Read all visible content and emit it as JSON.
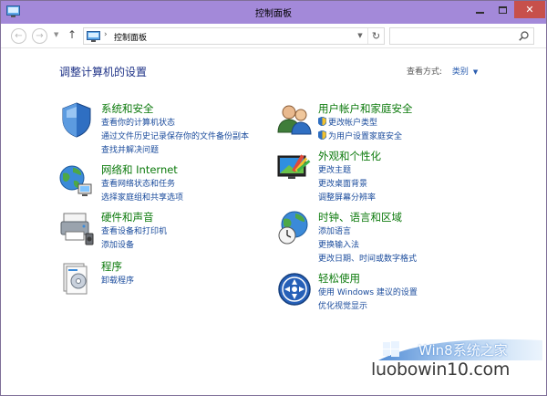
{
  "window": {
    "title": "控制面板"
  },
  "caption": {
    "close_glyph": "✕"
  },
  "nav": {
    "back_glyph": "←",
    "forward_glyph": "→",
    "dropdown_glyph": "▼",
    "up_glyph": "↑",
    "address_separator": "›",
    "address_path": "控制面板",
    "address_dropdown_glyph": "▼",
    "refresh_glyph": "↻",
    "search_placeholder": ""
  },
  "header": {
    "heading": "调整计算机的设置",
    "viewby_label": "查看方式:",
    "viewby_value": "类别",
    "viewby_caret": "▼"
  },
  "categories": [
    {
      "title": "系统和安全",
      "icon": "system-security-icon",
      "links": [
        "查看你的计算机状态",
        "通过文件历史记录保存你的文件备份副本",
        "查找并解决问题"
      ]
    },
    {
      "title": "网络和 Internet",
      "icon": "network-internet-icon",
      "links": [
        "查看网络状态和任务",
        "选择家庭组和共享选项"
      ]
    },
    {
      "title": "硬件和声音",
      "icon": "hardware-sound-icon",
      "links": [
        "查看设备和打印机",
        "添加设备"
      ]
    },
    {
      "title": "程序",
      "icon": "programs-icon",
      "links": [
        "卸载程序"
      ]
    },
    {
      "title": "用户帐户和家庭安全",
      "icon": "user-accounts-icon",
      "links": [
        "更改帐户类型",
        "为用户设置家庭安全"
      ]
    },
    {
      "title": "外观和个性化",
      "icon": "appearance-icon",
      "links": [
        "更改主题",
        "更改桌面背景",
        "调整屏幕分辨率"
      ]
    },
    {
      "title": "时钟、语言和区域",
      "icon": "clock-language-icon",
      "links": [
        "添加语言",
        "更换输入法",
        "更改日期、时间或数字格式"
      ]
    },
    {
      "title": "轻松使用",
      "icon": "ease-of-access-icon",
      "links": [
        "使用 Windows 建议的设置",
        "优化视觉显示"
      ]
    }
  ],
  "watermark": {
    "logo_text": "Win8系统之家",
    "site_text": "luobowin10.com"
  },
  "colors": {
    "titlebar": "#a389d9",
    "close_button": "#c7504b",
    "category_title": "#0c7a0c",
    "link": "#1a4b9c",
    "heading": "#1e3287"
  }
}
